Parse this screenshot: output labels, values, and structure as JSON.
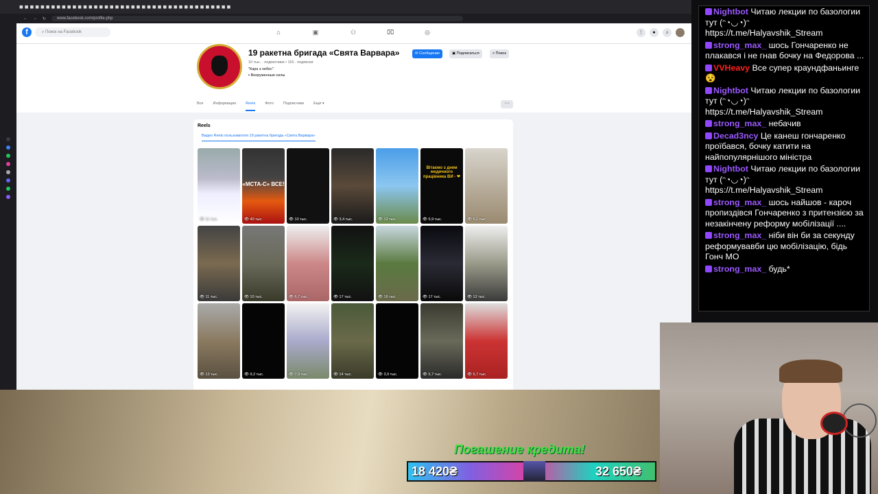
{
  "browser": {
    "url": "www.facebook.com/profile.php"
  },
  "fb": {
    "search_placeholder": "Поиск на Facebook",
    "page_name": "19 ракетна бригада «Свята Варвара»",
    "followers": "10 тыс. · подписчики • 116 · подписки",
    "quote": "\"Кара з небес\"",
    "category": "Вооруженные силы",
    "btn_message": "Сообщение",
    "btn_follow": "Подписаться",
    "btn_search": "Поиск",
    "tabs": [
      "Все",
      "Информация",
      "Reels",
      "Фото",
      "Подписчики",
      "Ещё"
    ],
    "reels_title": "Reels",
    "reels_subtitle": "Видео Reels пользователя 19 ракетна бригада «Свята Варвара»",
    "reels": [
      {
        "views": "11 тыс.",
        "overlay": ""
      },
      {
        "views": "40 тыс.",
        "overlay": "«МСТА-С» ВСЕ!"
      },
      {
        "views": "10 тыс.",
        "overlay": ""
      },
      {
        "views": "3,4 тыс.",
        "overlay": ""
      },
      {
        "views": "12 тыс.",
        "overlay": ""
      },
      {
        "views": "5,9 тыс.",
        "overlay": "Вітаємо з днем медичного працівника ВИ - ❤"
      },
      {
        "views": "5,1 тыс.",
        "overlay": ""
      },
      {
        "views": "11 тыс.",
        "overlay": ""
      },
      {
        "views": "10 тыс.",
        "overlay": ""
      },
      {
        "views": "6,7 тыс.",
        "overlay": ""
      },
      {
        "views": "17 тыс.",
        "overlay": ""
      },
      {
        "views": "16 тыс.",
        "overlay": ""
      },
      {
        "views": "17 тыс.",
        "overlay": ""
      },
      {
        "views": "12 тыс.",
        "overlay": ""
      },
      {
        "views": "13 тыс.",
        "overlay": ""
      },
      {
        "views": "9,2 тыс.",
        "overlay": ""
      },
      {
        "views": "7,9 тыс.",
        "overlay": ""
      },
      {
        "views": "14 тыс.",
        "overlay": ""
      },
      {
        "views": "3,9 тыс.",
        "overlay": ""
      },
      {
        "views": "5,7 тыс.",
        "overlay": ""
      },
      {
        "views": "5,7 тыс.",
        "overlay": ""
      }
    ]
  },
  "stream": {
    "banner": "Погашение кредита!",
    "bar_left": "18 420₴",
    "bar_right": "32 650₴"
  },
  "chat": [
    {
      "user": "Nightbot",
      "color": "#9b59ff",
      "text": "Читаю лекции по базологии тут (ᵔ◔◡◔)ᵔ https://t.me/Halyavshik_Stream"
    },
    {
      "user": "strong_max_",
      "color": "#9b59ff",
      "text": "шось Гончаренко не плакався і не гнав бочку на Федорова ..."
    },
    {
      "user": "VVHeavy",
      "color": "#ff2020",
      "text": "Все супер краундфаньинге 😵"
    },
    {
      "user": "Nightbot",
      "color": "#9b59ff",
      "text": "Читаю лекции по базологии тут (ᵔ◔◡◔)ᵔ https://t.me/Halyavshik_Stream"
    },
    {
      "user": "strong_max_",
      "color": "#9b59ff",
      "text": "небачив"
    },
    {
      "user": "Decad3ncy",
      "color": "#9b59ff",
      "text": "Це канеш гончаренко проїбався, бочку катити на найпопулярнішого міністра"
    },
    {
      "user": "Nightbot",
      "color": "#9b59ff",
      "text": "Читаю лекции по базологии тут (ᵔ◔◡◔)ᵔ https://t.me/Halyavshik_Stream"
    },
    {
      "user": "strong_max_",
      "color": "#9b59ff",
      "text": "шось найшов - кароч пропиздівся Гончаренко з притензією за незакінчену реформу мобілізації ...."
    },
    {
      "user": "strong_max_",
      "color": "#9b59ff",
      "text": "ніби він би за секунду реформувавби цю мобілізацію, бідь Гонч МО"
    },
    {
      "user": "strong_max_",
      "color": "#9b59ff",
      "text": "будь*"
    }
  ]
}
